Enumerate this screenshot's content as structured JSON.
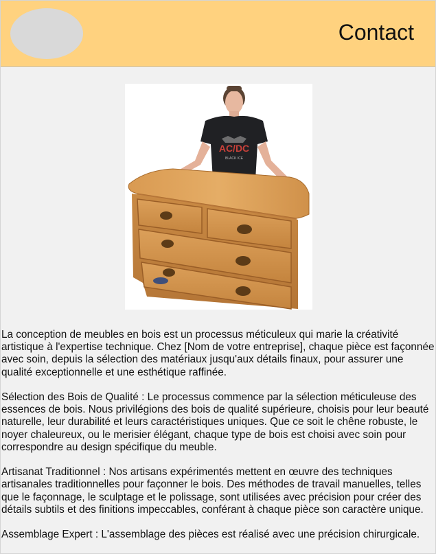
{
  "header": {
    "contact_label": "Contact"
  },
  "hero": {
    "tshirt_print": "AC/DC",
    "tshirt_sub": "BLACK ICE"
  },
  "content": {
    "intro": "La conception de meubles en bois est un processus méticuleux qui marie la créativité artistique à l'expertise technique. Chez [Nom de votre entreprise], chaque pièce est façonnée avec soin, depuis la sélection des matériaux jusqu'aux détails finaux, pour assurer une qualité exceptionnelle et une esthétique raffinée.",
    "section_wood": "Sélection des Bois de Qualité : Le processus commence par la sélection méticuleuse des essences de bois. Nous privilégions des bois de qualité supérieure, choisis pour leur beauté naturelle, leur durabilité et leurs caractéristiques uniques. Que ce soit le chêne robuste, le noyer chaleureux, ou le merisier élégant, chaque type de bois est choisi avec soin pour correspondre au design spécifique du meuble.",
    "section_craft": "Artisanat Traditionnel : Nos artisans expérimentés mettent en œuvre des techniques artisanales traditionnelles pour façonner le bois. Des méthodes de travail manuelles, telles que le façonnage, le sculptage et le polissage, sont utilisées avec précision pour créer des détails subtils et des finitions impeccables, conférant à chaque pièce son caractère unique.",
    "section_assembly": "Assemblage Expert : L'assemblage des pièces est réalisé avec une précision chirurgicale."
  }
}
